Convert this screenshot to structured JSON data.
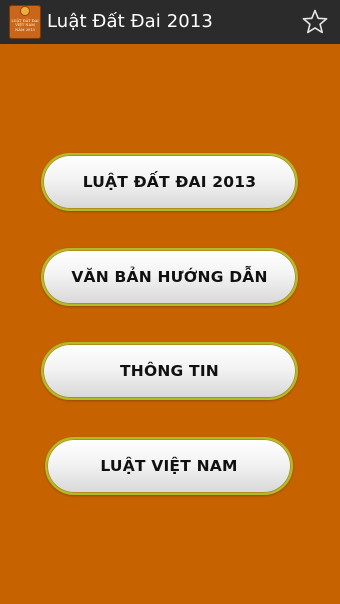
{
  "header": {
    "title": "Luật Đất Đai 2013",
    "app_icon_lines": [
      "LUẬT ĐẤT ĐAI",
      "VIỆT NAM",
      "NĂM 2013"
    ],
    "favorite_icon": "star-outline-icon"
  },
  "menu": {
    "items": [
      {
        "label": "LUẬT ĐẤT ĐAI 2013"
      },
      {
        "label": "VĂN BẢN HƯỚNG DẪN"
      },
      {
        "label": "THÔNG TIN"
      },
      {
        "label": "LUẬT VIỆT NAM"
      }
    ]
  },
  "colors": {
    "background": "#c76200",
    "action_bar": "#2b2b2b",
    "button_border": "#aebc25"
  }
}
